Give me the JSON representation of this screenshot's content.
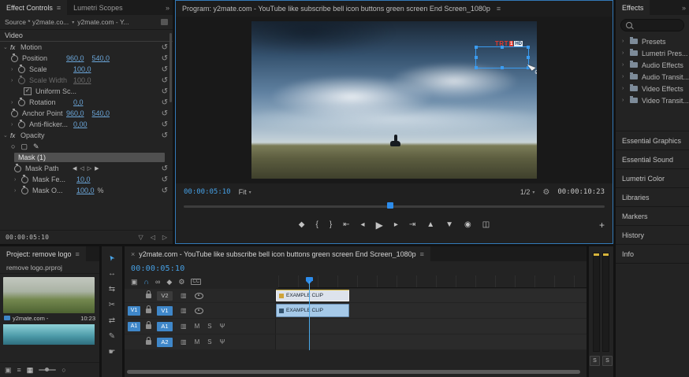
{
  "colors": {
    "accent_blue": "#2d8ceb",
    "timecode_blue": "#46a0e5",
    "value_blue": "#6ba6d9",
    "clip_blue": "#a5c9e8",
    "selection_yellow": "#d8b93e",
    "logo_red": "#e03a2f"
  },
  "icons": {
    "menu": "≡",
    "overflow": "»",
    "close": "×",
    "chevron_right": "›",
    "chevron_down": "⌄",
    "caret_down": "▾",
    "reset": "↺",
    "fx": "fx",
    "check": "✓",
    "blocked": "⊘",
    "add_marker": "◆",
    "mark_in": "{",
    "mark_out": "}",
    "go_to_in": "⇤",
    "step_back": "◂",
    "play": "▶",
    "step_forward": "▸",
    "go_to_out": "⇥",
    "lift": "▲",
    "extract": "▼",
    "export_frame": "◉",
    "comparison": "◫",
    "add": "+",
    "settings": "⚙",
    "ellipse_mask": "○",
    "rect_mask": "▢",
    "pen": "✎",
    "filter": "▽",
    "prev": "◀",
    "prev_small": "◁",
    "next_small": "▷",
    "next": "▶",
    "nest": "▣",
    "snap": "∩",
    "link": "∞",
    "cc": "CC",
    "sync_lock": "▥",
    "mic": "Ψ",
    "selection_tool": "➤",
    "track_select_tool": "↔",
    "ripple_tool": "⇆",
    "razor_tool": "✂",
    "slip_tool": "⇄",
    "pen_tool": "✎",
    "hand_tool": "☛"
  },
  "effect_controls": {
    "tab": "Effect Controls",
    "tab2": "Lumetri Scopes",
    "source_label": "Source * y2mate.co...",
    "source_clip": "y2mate.com - Y...",
    "section": "Video",
    "motion_label": "Motion",
    "position_label": "Position",
    "position_x": "960,0",
    "position_y": "540,0",
    "scale_label": "Scale",
    "scale_value": "100,0",
    "scale_width_label": "Scale Width",
    "scale_width_value": "100,0",
    "uniform_label": "Uniform Sc...",
    "rotation_label": "Rotation",
    "rotation_value": "0,0",
    "anchor_label": "Anchor Point",
    "anchor_x": "960,0",
    "anchor_y": "540,0",
    "antiflicker_label": "Anti-flicker...",
    "antiflicker_value": "0,00",
    "opacity_label": "Opacity",
    "mask_item": "Mask (1)",
    "mask_path_label": "Mask Path",
    "mask_feather_label": "Mask Fe...",
    "mask_feather_value": "10,0",
    "mask_opacity_label": "Mask O...",
    "mask_opacity_value": "100,0",
    "mask_opacity_unit": "%",
    "timecode": "00:00:05:10"
  },
  "program": {
    "title": "Program: y2mate.com - YouTube like subscribe bell icon buttons green screen End Screen_1080p",
    "logo_trt": "TRT",
    "logo_1": "1",
    "logo_hd": "HD",
    "current_time": "00:00:05:10",
    "fit": "Fit",
    "zoom": "1/2",
    "duration": "00:00:10:23"
  },
  "effects_panel": {
    "tab": "Effects",
    "tree": [
      "Presets",
      "Lumetri Pres...",
      "Audio Effects",
      "Audio Transit...",
      "Video Effects",
      "Video Transit..."
    ],
    "panels": [
      "Essential Graphics",
      "Essential Sound",
      "Lumetri Color",
      "Libraries",
      "Markers",
      "History",
      "Info"
    ]
  },
  "project": {
    "tab": "Project: remove logo",
    "item": "remove logo.prproj",
    "clip_name": "y2mate.com -",
    "clip_duration": "10:23"
  },
  "timeline": {
    "tab": "y2mate.com - YouTube like subscribe bell icon buttons green screen End Screen_1080p",
    "timecode": "00:00:05:10",
    "tracks": {
      "v2": {
        "name": "V2"
      },
      "v1": {
        "name": "V1",
        "source": "V1"
      },
      "a1": {
        "name": "A1",
        "source": "A1"
      },
      "a2": {
        "name": "A2"
      }
    },
    "mute": "M",
    "solo": "S",
    "clip_label": "EXAMPLE CLIP",
    "meter_solo": "S"
  }
}
